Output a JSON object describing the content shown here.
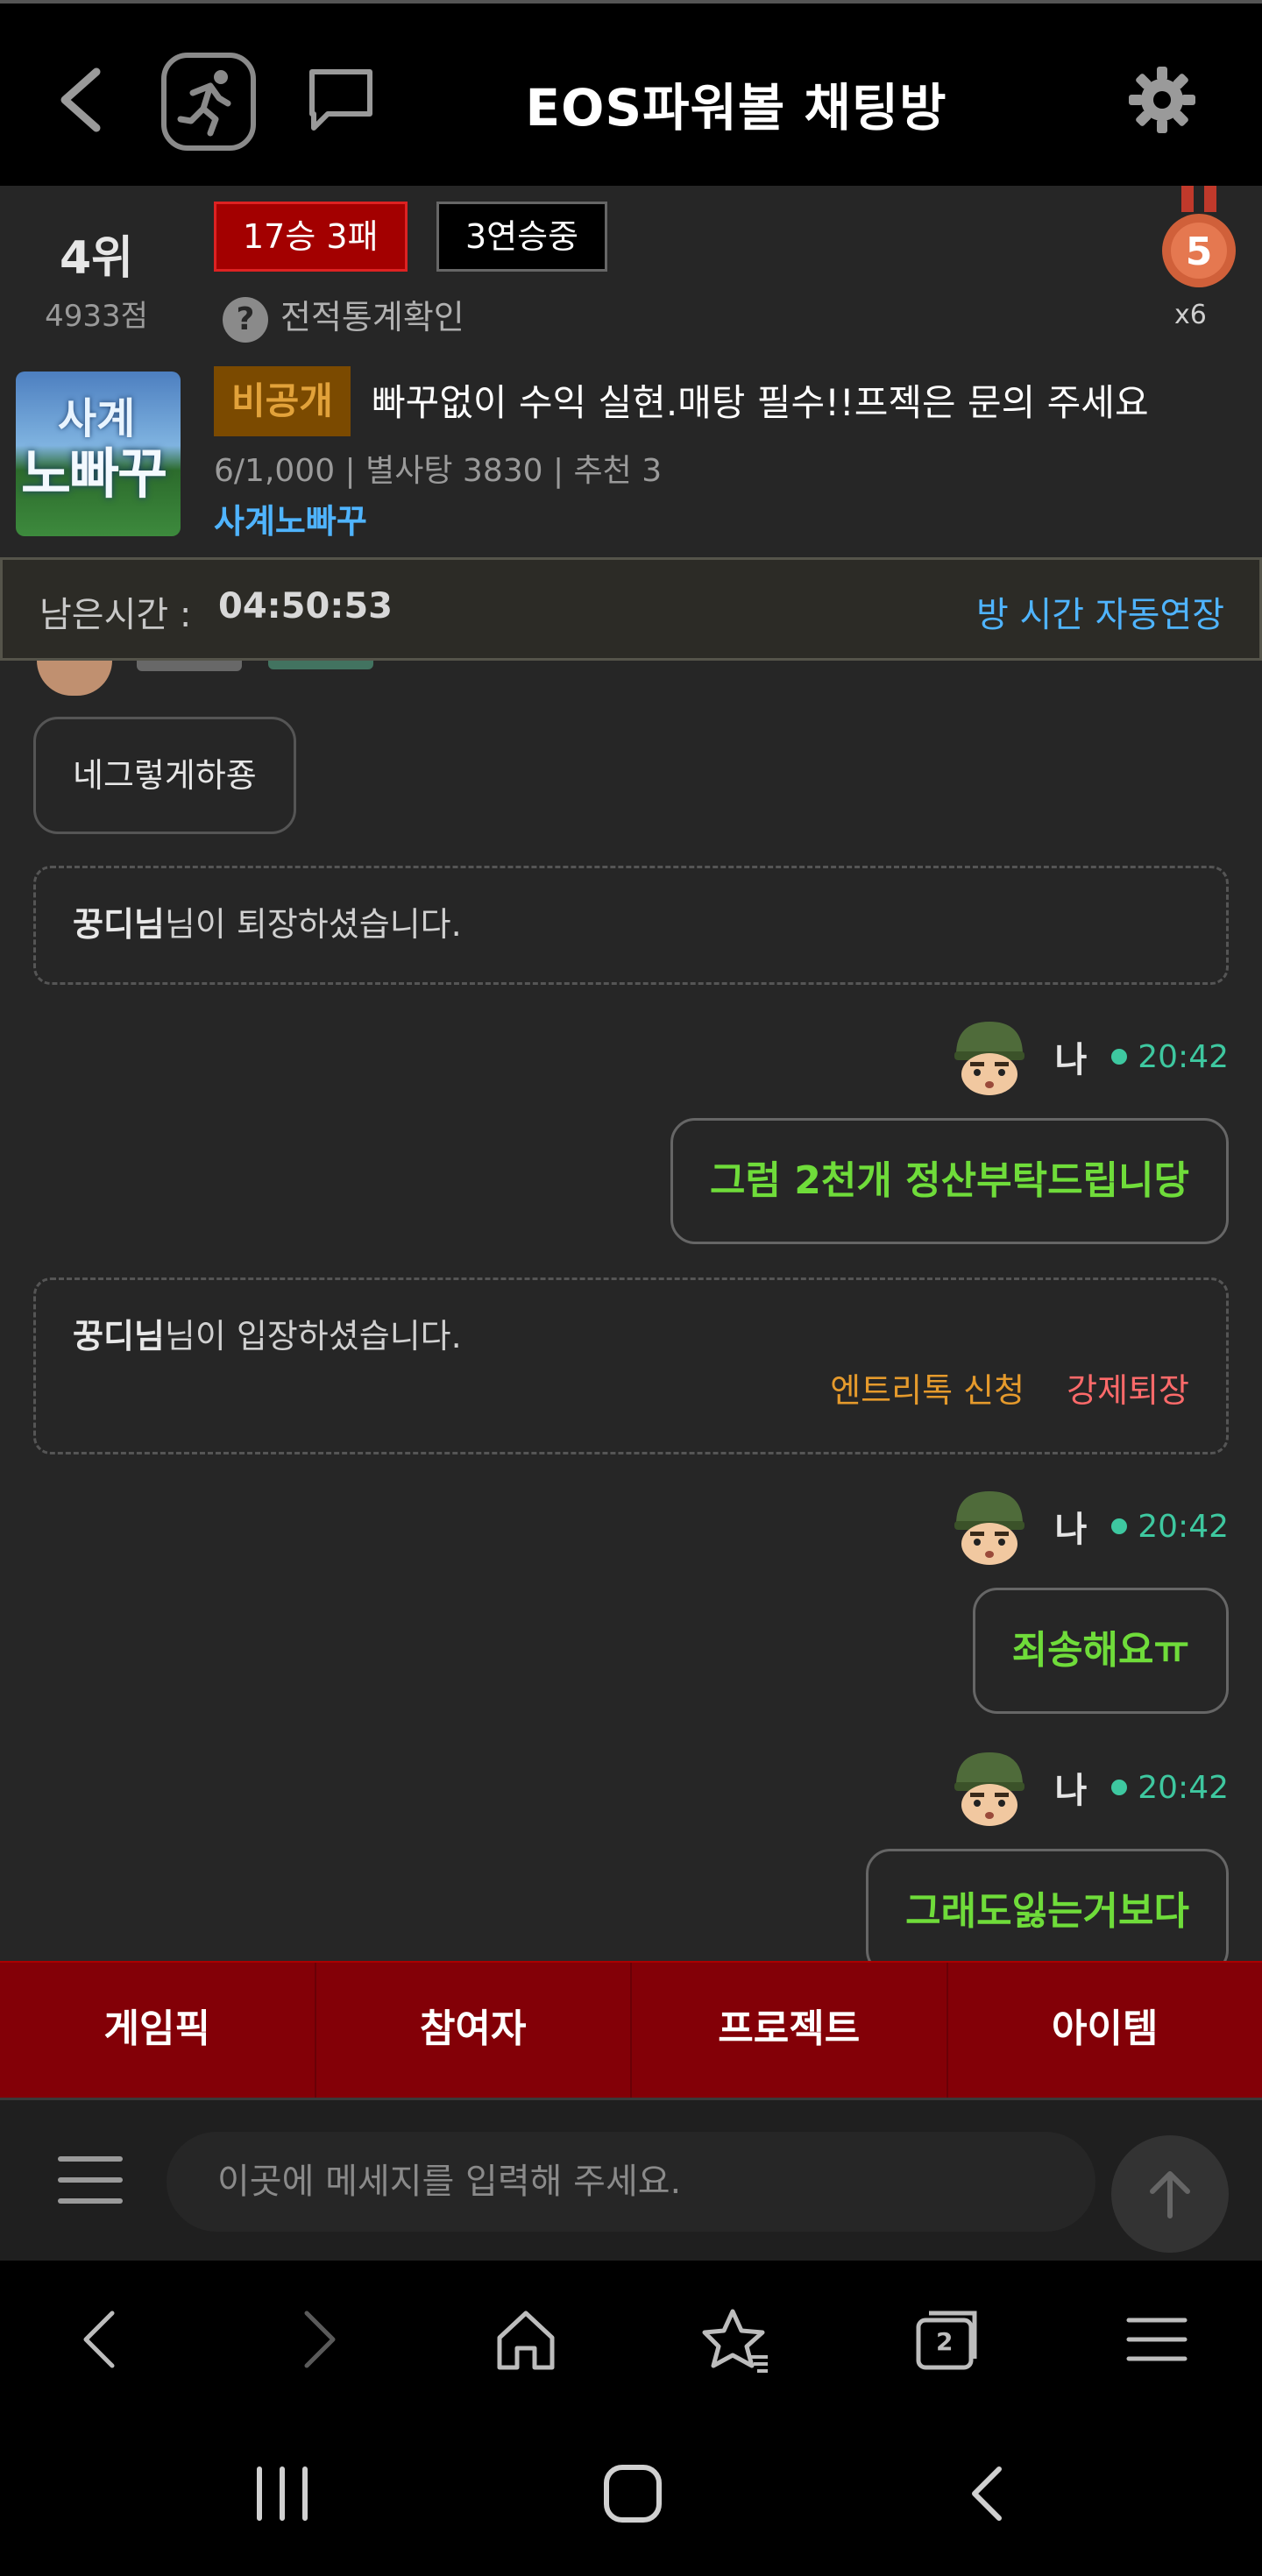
{
  "header": {
    "title": "EOS파워볼 채팅방"
  },
  "room": {
    "rank": "4위",
    "points": "4933점",
    "record": "17승 3패",
    "streak": "3연승중",
    "stats_link": "전적통계확인",
    "medal_level": "5",
    "medal_count": "x6",
    "thumb_line1": "사계",
    "thumb_line2": "노빠꾸",
    "private_badge": "비공개",
    "title": "빠꾸없이 수익 실현.매탕 필수!!프젝은 문의 주세요",
    "meta": "6/1,000 | 별사탕 3830 | 추천 3",
    "owner": "사계노빠꾸"
  },
  "timer": {
    "label": "남은시간 :",
    "value": "04:50:53",
    "extend_link": "방 시간 자동연장"
  },
  "messages": [
    {
      "type": "other",
      "text": "네그렇게하죵"
    },
    {
      "type": "system",
      "user": "꿍디님",
      "text": "님이 퇴장하셨습니다."
    },
    {
      "type": "mine",
      "sender": "나",
      "time": "20:42",
      "text": "그럼 2천개 정산부탁드립니당"
    },
    {
      "type": "system",
      "user": "꿍디님",
      "text": "님이 입장하셨습니다.",
      "action_entry": "엔트리톡 신청",
      "action_kick": "강제퇴장"
    },
    {
      "type": "mine",
      "sender": "나",
      "time": "20:42",
      "text": "죄송해요ㅠ"
    },
    {
      "type": "mine",
      "sender": "나",
      "time": "20:42",
      "text": "그래도잃는거보다"
    }
  ],
  "tabs": [
    "게임픽",
    "참여자",
    "프로젝트",
    "아이템"
  ],
  "input": {
    "placeholder": "이곳에 메세지를 입력해 주세요."
  },
  "browser": {
    "tab_count": "2"
  },
  "colors": {
    "accent_red": "#830007",
    "my_message_green": "#6fdc3a",
    "time_green": "#3ec8a0",
    "link_blue": "#4fb4ff"
  }
}
